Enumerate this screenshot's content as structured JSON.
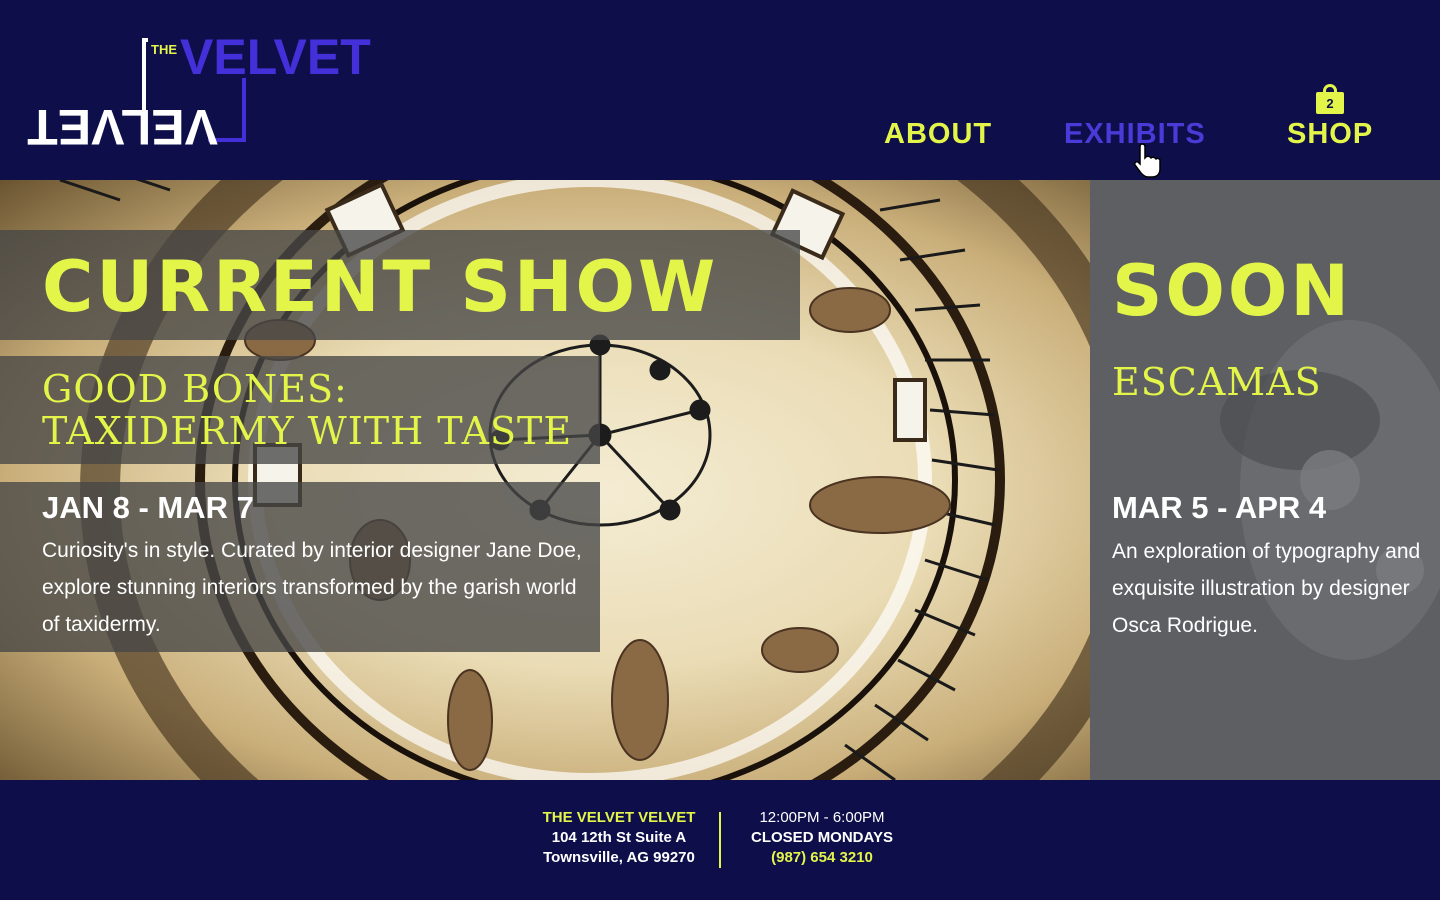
{
  "brand": {
    "logo_the": "THE",
    "logo_top": "VELVET",
    "logo_bottom": "VELVET"
  },
  "nav": {
    "about": "ABOUT",
    "exhibits": "EXHIBITS",
    "shop": "SHOP",
    "cart_count": "2"
  },
  "current": {
    "heading": "CURRENT SHOW",
    "title": "GOOD BONES: TAXIDERMY WITH TASTE",
    "dates": "JAN 8 - MAR 7",
    "description": "Curiosity's in style. Curated by interior designer Jane Doe, explore stunning interiors transformed by the garish world of taxidermy."
  },
  "soon": {
    "heading": "SOON",
    "title": "ESCAMAS",
    "dates": "MAR 5 - APR 4",
    "description": "An exploration of typography and exquisite illustration by designer Osca Rodrigue."
  },
  "footer": {
    "name": "THE VELVET VELVET",
    "address1": "104 12th St Suite A",
    "address2": "Townsville, AG 99270",
    "hours": "12:00PM - 6:00PM",
    "closed": "CLOSED MONDAYS",
    "phone": "(987) 654 3210"
  },
  "colors": {
    "navy": "#0e0f4a",
    "accent_yellow": "#e4f54a",
    "accent_purple": "#4a3ad8"
  }
}
